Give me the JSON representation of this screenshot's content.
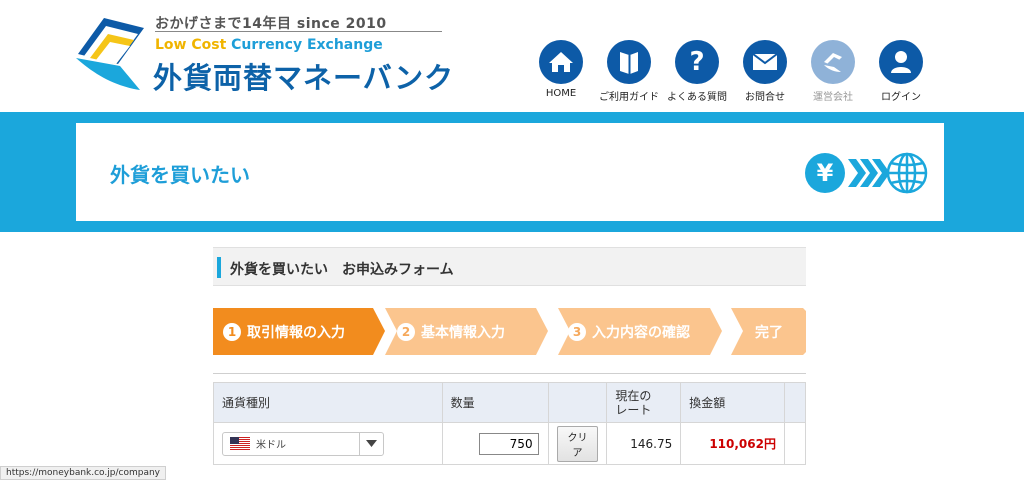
{
  "header": {
    "logo_tagline": "おかげさまで14年目 since 2010",
    "logo_sub_a": "Low Cost ",
    "logo_sub_b": "Currency Exchange",
    "logo_main": "外貨両替マネーバンク"
  },
  "nav": [
    {
      "label": "HOME",
      "icon": "home-icon"
    },
    {
      "label": "ご利用ガイド",
      "icon": "guide-book-icon"
    },
    {
      "label": "よくある質問",
      "icon": "question-icon"
    },
    {
      "label": "お問合せ",
      "icon": "mail-icon"
    },
    {
      "label": "運営会社",
      "icon": "company-icon"
    },
    {
      "label": "ログイン",
      "icon": "user-icon"
    }
  ],
  "banner": {
    "title": "外貨を買いたい",
    "icons": [
      "yen-icon",
      "arrows-icon",
      "globe-icon"
    ]
  },
  "form": {
    "heading": "外貨を買いたい　お申込みフォーム",
    "steps": [
      {
        "num": "1",
        "label": "取引情報の入力",
        "active": true
      },
      {
        "num": "2",
        "label": "基本情報入力",
        "active": false
      },
      {
        "num": "3",
        "label": "入力内容の確認",
        "active": false
      },
      {
        "num": "",
        "label": "完了",
        "active": false
      }
    ]
  },
  "table": {
    "headers": [
      "通貨種別",
      "数量",
      "",
      "現在の\nレート",
      "換金額",
      ""
    ],
    "row": {
      "currency": "米ドル",
      "quantity": "750",
      "clear_label": "クリア",
      "rate": "146.75",
      "amount": "110,062円"
    }
  },
  "status_bar": {
    "url": "https://moneybank.co.jp/company"
  },
  "colors": {
    "brand_blue": "#0d5aa7",
    "banner_cyan": "#1ba7dc",
    "step_active": "#f28c1e",
    "step_inactive": "#fbc58e",
    "amount_red": "#cc0000"
  }
}
